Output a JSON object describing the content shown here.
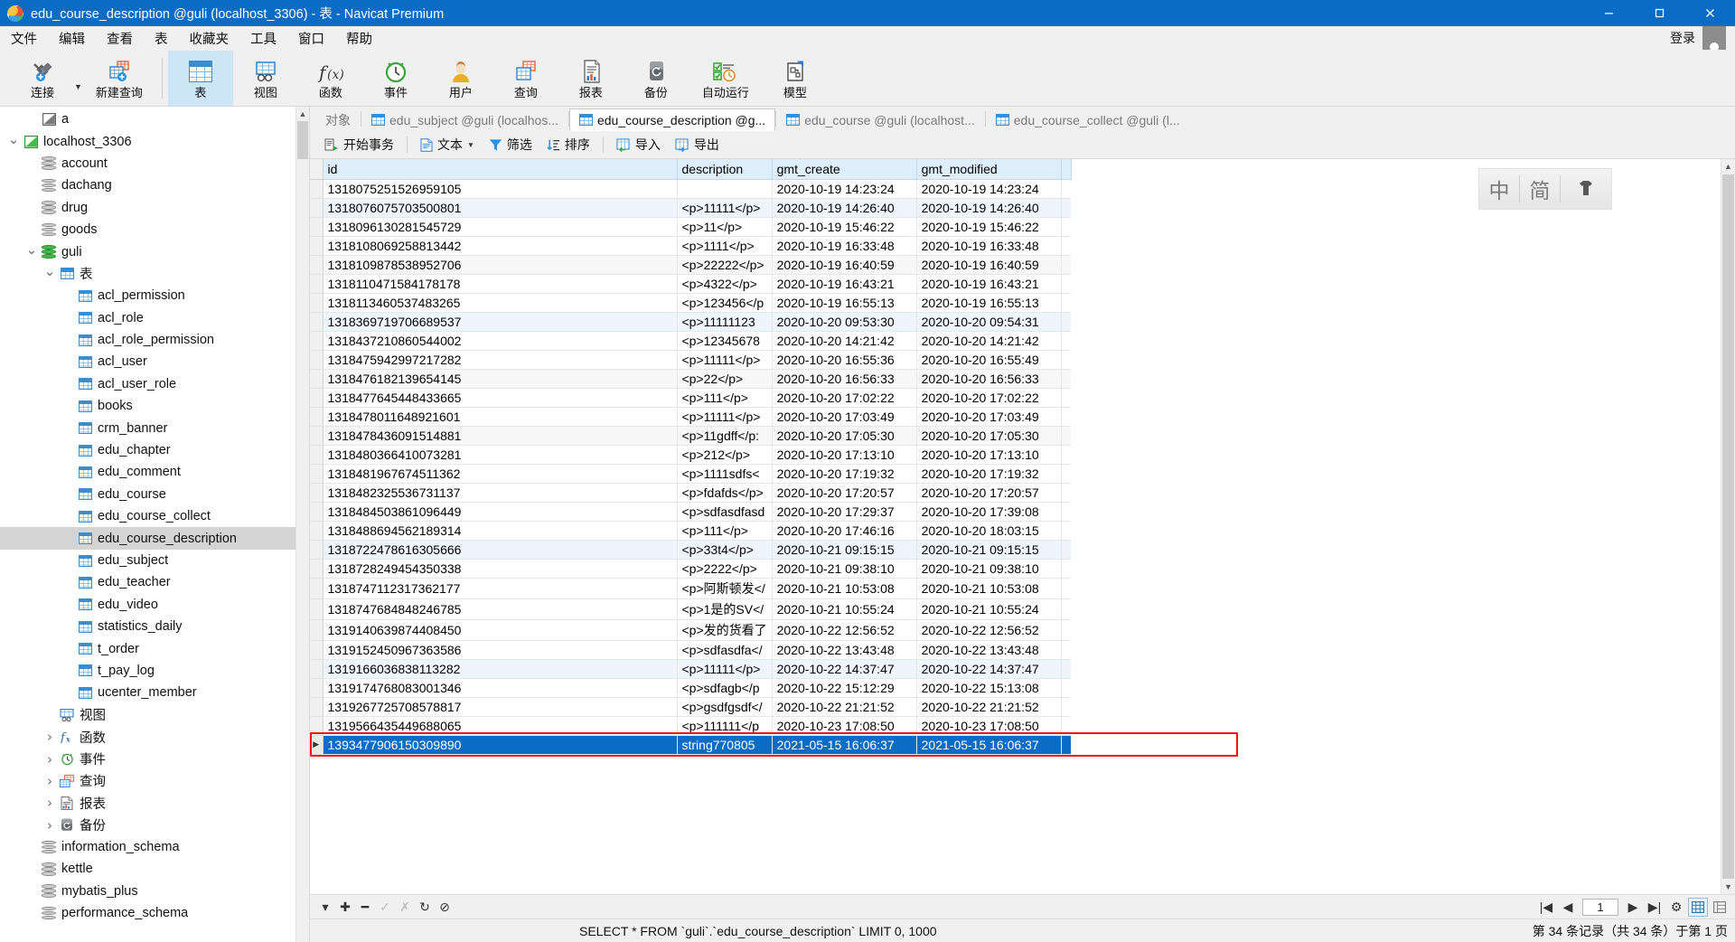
{
  "window": {
    "title": "edu_course_description @guli (localhost_3306) - 表 - Navicat Premium",
    "minimize": "─",
    "maximize": "□",
    "close": "✕"
  },
  "menu": {
    "items": [
      "文件",
      "编辑",
      "查看",
      "表",
      "收藏夹",
      "工具",
      "窗口",
      "帮助"
    ],
    "login_label": "登录"
  },
  "toolbar": {
    "items": [
      {
        "label": "连接",
        "icon": "connection-icon",
        "selected": false,
        "caret": true
      },
      {
        "label": "新建查询",
        "icon": "new-query-icon",
        "selected": false,
        "caret": false
      },
      {
        "label": "表",
        "icon": "table-icon",
        "selected": true,
        "caret": false
      },
      {
        "label": "视图",
        "icon": "view-icon",
        "selected": false,
        "caret": false
      },
      {
        "label": "函数",
        "icon": "function-icon",
        "selected": false,
        "caret": false
      },
      {
        "label": "事件",
        "icon": "event-clock-icon",
        "selected": false,
        "caret": false
      },
      {
        "label": "用户",
        "icon": "user-icon",
        "selected": false,
        "caret": false
      },
      {
        "label": "查询",
        "icon": "query-icon",
        "selected": false,
        "caret": false
      },
      {
        "label": "报表",
        "icon": "report-icon",
        "selected": false,
        "caret": false
      },
      {
        "label": "备份",
        "icon": "backup-icon",
        "selected": false,
        "caret": false
      },
      {
        "label": "自动运行",
        "icon": "automation-icon",
        "selected": false,
        "caret": false
      },
      {
        "label": "模型",
        "icon": "model-icon",
        "selected": false,
        "caret": false
      }
    ]
  },
  "sidebar": {
    "nodes": [
      {
        "label": "a",
        "indent": 1,
        "arrow": "",
        "icon": "connection-gray-icon"
      },
      {
        "label": "localhost_3306",
        "indent": 0,
        "arrow": "v",
        "icon": "connection-green-icon"
      },
      {
        "label": "account",
        "indent": 1,
        "arrow": "",
        "icon": "database-icon"
      },
      {
        "label": "dachang",
        "indent": 1,
        "arrow": "",
        "icon": "database-icon"
      },
      {
        "label": "drug",
        "indent": 1,
        "arrow": "",
        "icon": "database-icon"
      },
      {
        "label": "goods",
        "indent": 1,
        "arrow": "",
        "icon": "database-icon"
      },
      {
        "label": "guli",
        "indent": 1,
        "arrow": "v",
        "icon": "database-green-icon"
      },
      {
        "label": "表",
        "indent": 2,
        "arrow": "v",
        "icon": "table-folder-icon"
      },
      {
        "label": "acl_permission",
        "indent": 3,
        "arrow": "",
        "icon": "table-icon"
      },
      {
        "label": "acl_role",
        "indent": 3,
        "arrow": "",
        "icon": "table-icon"
      },
      {
        "label": "acl_role_permission",
        "indent": 3,
        "arrow": "",
        "icon": "table-icon"
      },
      {
        "label": "acl_user",
        "indent": 3,
        "arrow": "",
        "icon": "table-icon"
      },
      {
        "label": "acl_user_role",
        "indent": 3,
        "arrow": "",
        "icon": "table-icon"
      },
      {
        "label": "books",
        "indent": 3,
        "arrow": "",
        "icon": "table-icon"
      },
      {
        "label": "crm_banner",
        "indent": 3,
        "arrow": "",
        "icon": "table-icon"
      },
      {
        "label": "edu_chapter",
        "indent": 3,
        "arrow": "",
        "icon": "table-icon"
      },
      {
        "label": "edu_comment",
        "indent": 3,
        "arrow": "",
        "icon": "table-icon"
      },
      {
        "label": "edu_course",
        "indent": 3,
        "arrow": "",
        "icon": "table-icon"
      },
      {
        "label": "edu_course_collect",
        "indent": 3,
        "arrow": "",
        "icon": "table-icon"
      },
      {
        "label": "edu_course_description",
        "indent": 3,
        "arrow": "",
        "icon": "table-icon",
        "selected": true
      },
      {
        "label": "edu_subject",
        "indent": 3,
        "arrow": "",
        "icon": "table-icon"
      },
      {
        "label": "edu_teacher",
        "indent": 3,
        "arrow": "",
        "icon": "table-icon"
      },
      {
        "label": "edu_video",
        "indent": 3,
        "arrow": "",
        "icon": "table-icon"
      },
      {
        "label": "statistics_daily",
        "indent": 3,
        "arrow": "",
        "icon": "table-icon"
      },
      {
        "label": "t_order",
        "indent": 3,
        "arrow": "",
        "icon": "table-icon"
      },
      {
        "label": "t_pay_log",
        "indent": 3,
        "arrow": "",
        "icon": "table-icon"
      },
      {
        "label": "ucenter_member",
        "indent": 3,
        "arrow": "",
        "icon": "table-icon"
      },
      {
        "label": "视图",
        "indent": 2,
        "arrow": "",
        "icon": "view-icon"
      },
      {
        "label": "函数",
        "indent": 2,
        "arrow": ">",
        "icon": "function-icon"
      },
      {
        "label": "事件",
        "indent": 2,
        "arrow": ">",
        "icon": "event-clock-icon"
      },
      {
        "label": "查询",
        "indent": 2,
        "arrow": ">",
        "icon": "query-icon"
      },
      {
        "label": "报表",
        "indent": 2,
        "arrow": ">",
        "icon": "report-icon"
      },
      {
        "label": "备份",
        "indent": 2,
        "arrow": ">",
        "icon": "backup-icon"
      },
      {
        "label": "information_schema",
        "indent": 1,
        "arrow": "",
        "icon": "database-icon"
      },
      {
        "label": "kettle",
        "indent": 1,
        "arrow": "",
        "icon": "database-icon"
      },
      {
        "label": "mybatis_plus",
        "indent": 1,
        "arrow": "",
        "icon": "database-icon"
      },
      {
        "label": "performance_schema",
        "indent": 1,
        "arrow": "",
        "icon": "database-icon"
      }
    ]
  },
  "tabs": [
    {
      "label": "对象",
      "icon": "",
      "active": false
    },
    {
      "label": "edu_subject @guli (localhos...",
      "icon": "table-icon",
      "active": false
    },
    {
      "label": "edu_course_description @g...",
      "icon": "table-icon",
      "active": true
    },
    {
      "label": "edu_course @guli (localhost...",
      "icon": "table-icon",
      "active": false
    },
    {
      "label": "edu_course_collect @guli (l...",
      "icon": "table-icon",
      "active": false
    }
  ],
  "grid_toolbar": {
    "buttons": [
      {
        "label": "开始事务",
        "icon": "transaction-icon",
        "caret": false
      },
      {
        "label": "文本",
        "icon": "text-icon",
        "caret": true
      },
      {
        "label": "筛选",
        "icon": "filter-icon",
        "caret": false
      },
      {
        "label": "排序",
        "icon": "sort-icon",
        "caret": false
      },
      {
        "label": "导入",
        "icon": "import-icon",
        "caret": false
      },
      {
        "label": "导出",
        "icon": "export-icon",
        "caret": false
      }
    ]
  },
  "watermark": {
    "left": "中",
    "right": "简"
  },
  "table": {
    "columns": [
      "id",
      "description",
      "gmt_create",
      "gmt_modified"
    ],
    "rows": [
      {
        "id": "1318075251526959105",
        "description": "",
        "gmt_create": "2020-10-19 14:23:24",
        "gmt_modified": "2020-10-19 14:23:24",
        "style": "plain"
      },
      {
        "id": "1318076075703500801",
        "description": "<p>11111</p>",
        "gmt_create": "2020-10-19 14:26:40",
        "gmt_modified": "2020-10-19 14:26:40",
        "style": "tint"
      },
      {
        "id": "1318096130281545729",
        "description": "<p>11</p>",
        "gmt_create": "2020-10-19 15:46:22",
        "gmt_modified": "2020-10-19 15:46:22",
        "style": "plain"
      },
      {
        "id": "1318108069258813442",
        "description": "<p>1111</p>",
        "gmt_create": "2020-10-19 16:33:48",
        "gmt_modified": "2020-10-19 16:33:48",
        "style": "plain"
      },
      {
        "id": "1318109878538952706",
        "description": "<p>22222</p>",
        "gmt_create": "2020-10-19 16:40:59",
        "gmt_modified": "2020-10-19 16:40:59",
        "style": "alt"
      },
      {
        "id": "1318110471584178178",
        "description": "<p>4322</p>",
        "gmt_create": "2020-10-19 16:43:21",
        "gmt_modified": "2020-10-19 16:43:21",
        "style": "plain"
      },
      {
        "id": "1318113460537483265",
        "description": "<p>123456</p",
        "gmt_create": "2020-10-19 16:55:13",
        "gmt_modified": "2020-10-19 16:55:13",
        "style": "plain"
      },
      {
        "id": "1318369719706689537",
        "description": "<p>11111123",
        "gmt_create": "2020-10-20 09:53:30",
        "gmt_modified": "2020-10-20 09:54:31",
        "style": "tint"
      },
      {
        "id": "1318437210860544002",
        "description": "<p>12345678",
        "gmt_create": "2020-10-20 14:21:42",
        "gmt_modified": "2020-10-20 14:21:42",
        "style": "plain"
      },
      {
        "id": "1318475942997217282",
        "description": "<p>11111</p>",
        "gmt_create": "2020-10-20 16:55:36",
        "gmt_modified": "2020-10-20 16:55:49",
        "style": "plain"
      },
      {
        "id": "1318476182139654145",
        "description": "<p>22</p>",
        "gmt_create": "2020-10-20 16:56:33",
        "gmt_modified": "2020-10-20 16:56:33",
        "style": "alt"
      },
      {
        "id": "1318477645448433665",
        "description": "<p>111</p>",
        "gmt_create": "2020-10-20 17:02:22",
        "gmt_modified": "2020-10-20 17:02:22",
        "style": "plain"
      },
      {
        "id": "1318478011648921601",
        "description": "<p>11111</p>",
        "gmt_create": "2020-10-20 17:03:49",
        "gmt_modified": "2020-10-20 17:03:49",
        "style": "plain"
      },
      {
        "id": "1318478436091514881",
        "description": "<p>11gdff</p:",
        "gmt_create": "2020-10-20 17:05:30",
        "gmt_modified": "2020-10-20 17:05:30",
        "style": "alt"
      },
      {
        "id": "1318480366410073281",
        "description": "<p>212</p>",
        "gmt_create": "2020-10-20 17:13:10",
        "gmt_modified": "2020-10-20 17:13:10",
        "style": "plain"
      },
      {
        "id": "1318481967674511362",
        "description": "<p>1111sdfs<",
        "gmt_create": "2020-10-20 17:19:32",
        "gmt_modified": "2020-10-20 17:19:32",
        "style": "plain"
      },
      {
        "id": "1318482325536731137",
        "description": "<p>fdafds</p>",
        "gmt_create": "2020-10-20 17:20:57",
        "gmt_modified": "2020-10-20 17:20:57",
        "style": "plain"
      },
      {
        "id": "1318484503861096449",
        "description": "<p>sdfasdfasd",
        "gmt_create": "2020-10-20 17:29:37",
        "gmt_modified": "2020-10-20 17:39:08",
        "style": "plain"
      },
      {
        "id": "1318488694562189314",
        "description": "<p>111</p>",
        "gmt_create": "2020-10-20 17:46:16",
        "gmt_modified": "2020-10-20 18:03:15",
        "style": "plain"
      },
      {
        "id": "1318722478616305666",
        "description": "<p>33t4</p>",
        "gmt_create": "2020-10-21 09:15:15",
        "gmt_modified": "2020-10-21 09:15:15",
        "style": "tint"
      },
      {
        "id": "1318728249454350338",
        "description": "<p>2222</p>",
        "gmt_create": "2020-10-21 09:38:10",
        "gmt_modified": "2020-10-21 09:38:10",
        "style": "plain"
      },
      {
        "id": "1318747112317362177",
        "description": "<p>阿斯顿发</",
        "gmt_create": "2020-10-21 10:53:08",
        "gmt_modified": "2020-10-21 10:53:08",
        "style": "plain"
      },
      {
        "id": "1318747684848246785",
        "description": "<p>1是的SV</",
        "gmt_create": "2020-10-21 10:55:24",
        "gmt_modified": "2020-10-21 10:55:24",
        "style": "plain"
      },
      {
        "id": "1319140639874408450",
        "description": "<p>发的货看了",
        "gmt_create": "2020-10-22 12:56:52",
        "gmt_modified": "2020-10-22 12:56:52",
        "style": "plain"
      },
      {
        "id": "1319152450967363586",
        "description": "<p>sdfasdfa</",
        "gmt_create": "2020-10-22 13:43:48",
        "gmt_modified": "2020-10-22 13:43:48",
        "style": "plain"
      },
      {
        "id": "1319166036838113282",
        "description": "<p>11111</p>",
        "gmt_create": "2020-10-22 14:37:47",
        "gmt_modified": "2020-10-22 14:37:47",
        "style": "tint"
      },
      {
        "id": "1319174768083001346",
        "description": "<p>sdfagb</p",
        "gmt_create": "2020-10-22 15:12:29",
        "gmt_modified": "2020-10-22 15:13:08",
        "style": "plain"
      },
      {
        "id": "1319267725708578817",
        "description": "<p>gsdfgsdf</",
        "gmt_create": "2020-10-22 21:21:52",
        "gmt_modified": "2020-10-22 21:21:52",
        "style": "plain"
      },
      {
        "id": "1319566435449688065",
        "description": "<p>111111</p",
        "gmt_create": "2020-10-23 17:08:50",
        "gmt_modified": "2020-10-23 17:08:50",
        "style": "plain"
      },
      {
        "id": "1393477906150309890",
        "description": "string770805",
        "gmt_create": "2021-05-15 16:06:37",
        "gmt_modified": "2021-05-15 16:06:37",
        "style": "selected"
      }
    ]
  },
  "record_nav": {
    "buttons": [
      "▾",
      "✚",
      "━",
      "✓",
      "✗",
      "↻",
      "⊘"
    ],
    "page_value": "1",
    "first": "|◀",
    "prev": "◀",
    "next": "▶",
    "last": "▶|",
    "settings": "⚙",
    "grid_view": "grid-view-icon",
    "form_view": "form-view-icon"
  },
  "status": {
    "sql": "SELECT * FROM `guli`.`edu_course_description` LIMIT 0, 1000",
    "records": "第 34 条记录（共 34 条）于第 1 页"
  }
}
